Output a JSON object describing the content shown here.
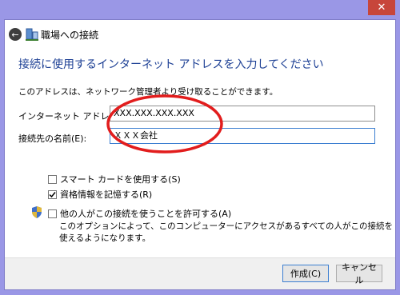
{
  "window": {
    "title": "職場への接続",
    "close_glyph": "✕"
  },
  "nav": {
    "back_glyph": "←",
    "net_icon": "network-icon"
  },
  "heading": "接続に使用するインターネット アドレスを入力してください",
  "description": "このアドレスは、ネットワーク管理者より受け取ることができます。",
  "fields": {
    "address_label": "インターネット アドレス(I):",
    "address_value": "XXX.XXX.XXX.XXX",
    "name_label": "接続先の名前(E):",
    "name_value": "ＸＸＸ会社"
  },
  "options": {
    "smart_card_label": "スマート カードを使用する(S)",
    "smart_card_checked": false,
    "remember_label": "資格情報を記憶する(R)",
    "remember_checked": true,
    "allow_others_label": "他の人がこの接続を使うことを許可する(A)",
    "allow_others_checked": false,
    "allow_others_note": "このオプションによって、このコンピューターにアクセスがあるすべての人がこの接続を使えるようになります。"
  },
  "buttons": {
    "create": "作成(C)",
    "cancel": "キャンセル"
  },
  "colors": {
    "title_bar": "#9a97e6",
    "heading": "#1c3f94",
    "annotation": "#e21d1d",
    "close": "#c7463b"
  }
}
